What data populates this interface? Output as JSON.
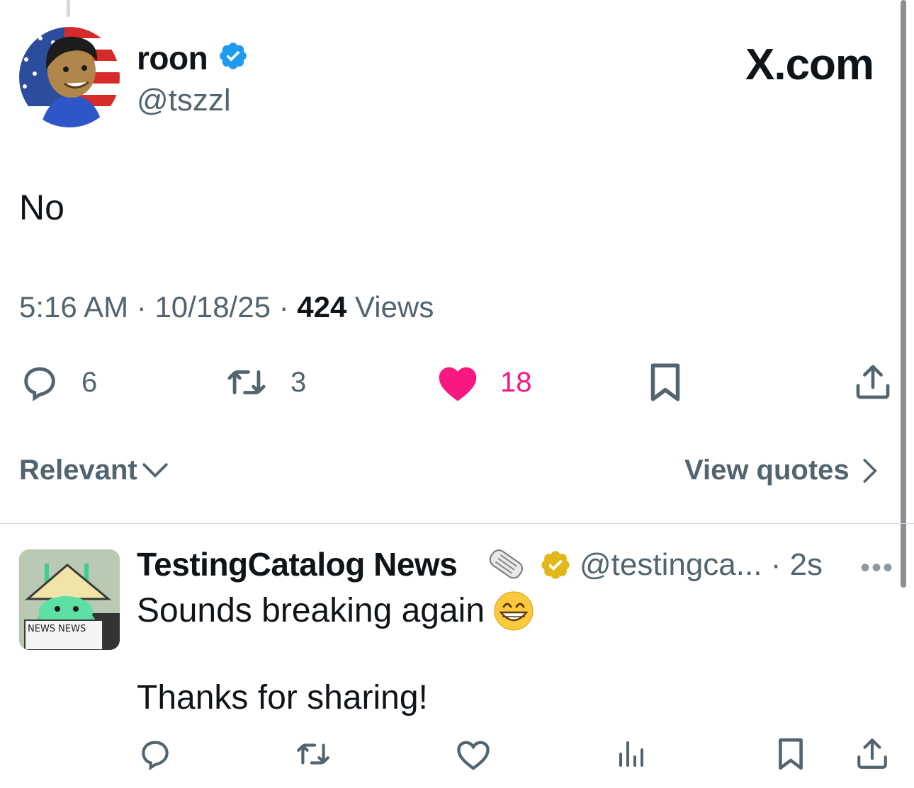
{
  "tweet": {
    "author_name": "roon",
    "author_handle": "@tszzl",
    "brand": "X.com",
    "text": "No",
    "time": "5:16 AM",
    "date": "10/18/25",
    "views_count": "424",
    "views_label": "Views",
    "meta_sep": "·",
    "replies": "6",
    "reposts": "3",
    "likes": "18"
  },
  "controls": {
    "sort_label": "Relevant",
    "view_quotes_label": "View quotes"
  },
  "reply": {
    "author_name": "TestingCatalog News",
    "author_handle": "@testingca...",
    "sep": "·",
    "time": "2s",
    "more": "•••",
    "line1": "Sounds breaking again",
    "line2": "Thanks for sharing!",
    "avatar_text": "NEWS NEWS"
  },
  "colors": {
    "like": "#f91880",
    "verified_blue": "#1d9bf0",
    "verified_gold": "#e2b719",
    "muted": "#536471"
  },
  "icons": [
    "reply-icon",
    "repost-icon",
    "like-icon",
    "bookmark-icon",
    "share-icon",
    "views-icon",
    "chevron-down-icon",
    "chevron-right-icon",
    "verified-badge-icon",
    "newspaper-emoji",
    "grin-emoji"
  ]
}
